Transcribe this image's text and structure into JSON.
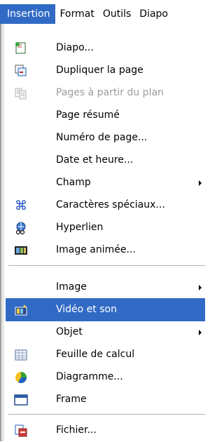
{
  "menubar": {
    "items": [
      {
        "label": "Insertion",
        "active": true
      },
      {
        "label": "Format",
        "active": false
      },
      {
        "label": "Outils",
        "active": false
      },
      {
        "label": "Diapo",
        "active": false
      }
    ]
  },
  "menu": {
    "items": [
      {
        "label": "Diapo...",
        "icon": "new-slide-icon",
        "enabled": true
      },
      {
        "label": "Dupliquer la page",
        "icon": "duplicate-page-icon",
        "enabled": true
      },
      {
        "label": "Pages à partir du plan",
        "icon": "pages-from-outline-icon",
        "enabled": false
      },
      {
        "label": "Page résumé",
        "icon": "",
        "enabled": true
      },
      {
        "label": "Numéro de page...",
        "icon": "",
        "enabled": true
      },
      {
        "label": "Date et heure...",
        "icon": "",
        "enabled": true
      },
      {
        "label": "Champ",
        "icon": "",
        "enabled": true,
        "submenu": true
      },
      {
        "label": "Caractères spéciaux...",
        "icon": "special-characters-icon",
        "enabled": true
      },
      {
        "label": "Hyperlien",
        "icon": "hyperlink-icon",
        "enabled": true
      },
      {
        "label": "Image animée...",
        "icon": "animated-image-icon",
        "enabled": true
      },
      {
        "label": "Image",
        "icon": "",
        "enabled": true,
        "submenu": true
      },
      {
        "label": "Vidéo et son",
        "icon": "video-sound-icon",
        "enabled": true,
        "highlighted": true
      },
      {
        "label": "Objet",
        "icon": "",
        "enabled": true,
        "submenu": true
      },
      {
        "label": "Feuille de calcul",
        "icon": "spreadsheet-icon",
        "enabled": true
      },
      {
        "label": "Diagramme...",
        "icon": "chart-icon",
        "enabled": true
      },
      {
        "label": "Frame",
        "icon": "frame-icon",
        "enabled": true
      },
      {
        "label": "Fichier...",
        "icon": "file-icon",
        "enabled": true
      }
    ]
  },
  "colors": {
    "highlight": "#316ac5",
    "disabled_text": "#9c9c9c"
  }
}
